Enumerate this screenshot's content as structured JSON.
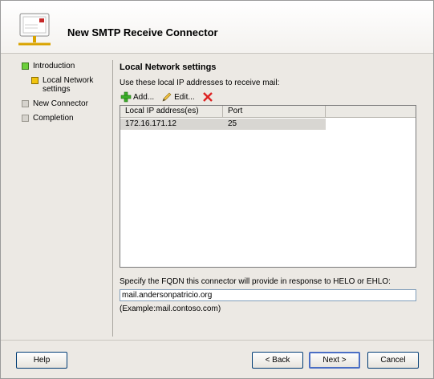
{
  "header": {
    "title": "New SMTP Receive Connector"
  },
  "steps": [
    {
      "label": "Introduction",
      "state": "complete"
    },
    {
      "label": "Local Network settings",
      "state": "current"
    },
    {
      "label": "New Connector",
      "state": "pending"
    },
    {
      "label": "Completion",
      "state": "pending"
    }
  ],
  "section": {
    "title": "Local Network settings",
    "instruction": "Use these local IP addresses to receive mail:"
  },
  "toolbar": {
    "add_label": "Add...",
    "edit_label": "Edit...",
    "add_icon": "green-plus-icon",
    "edit_icon": "pencil-icon",
    "remove_icon": "red-x-icon"
  },
  "grid": {
    "columns": [
      "Local IP address(es)",
      "Port"
    ],
    "rows": [
      {
        "ip": "172.16.171.12",
        "port": "25"
      }
    ]
  },
  "fqdn": {
    "label": "Specify the FQDN this connector will provide in response to HELO or EHLO:",
    "value": "mail.andersonpatricio.org",
    "example": "(Example:mail.contoso.com)"
  },
  "buttons": {
    "help": "Help",
    "back": "< Back",
    "next": "Next >",
    "cancel": "Cancel"
  },
  "colors": {
    "complete": "#6ccf3a",
    "current": "#f1c40f",
    "pending": "#d6d3cd",
    "accent_border": "#003c74"
  }
}
